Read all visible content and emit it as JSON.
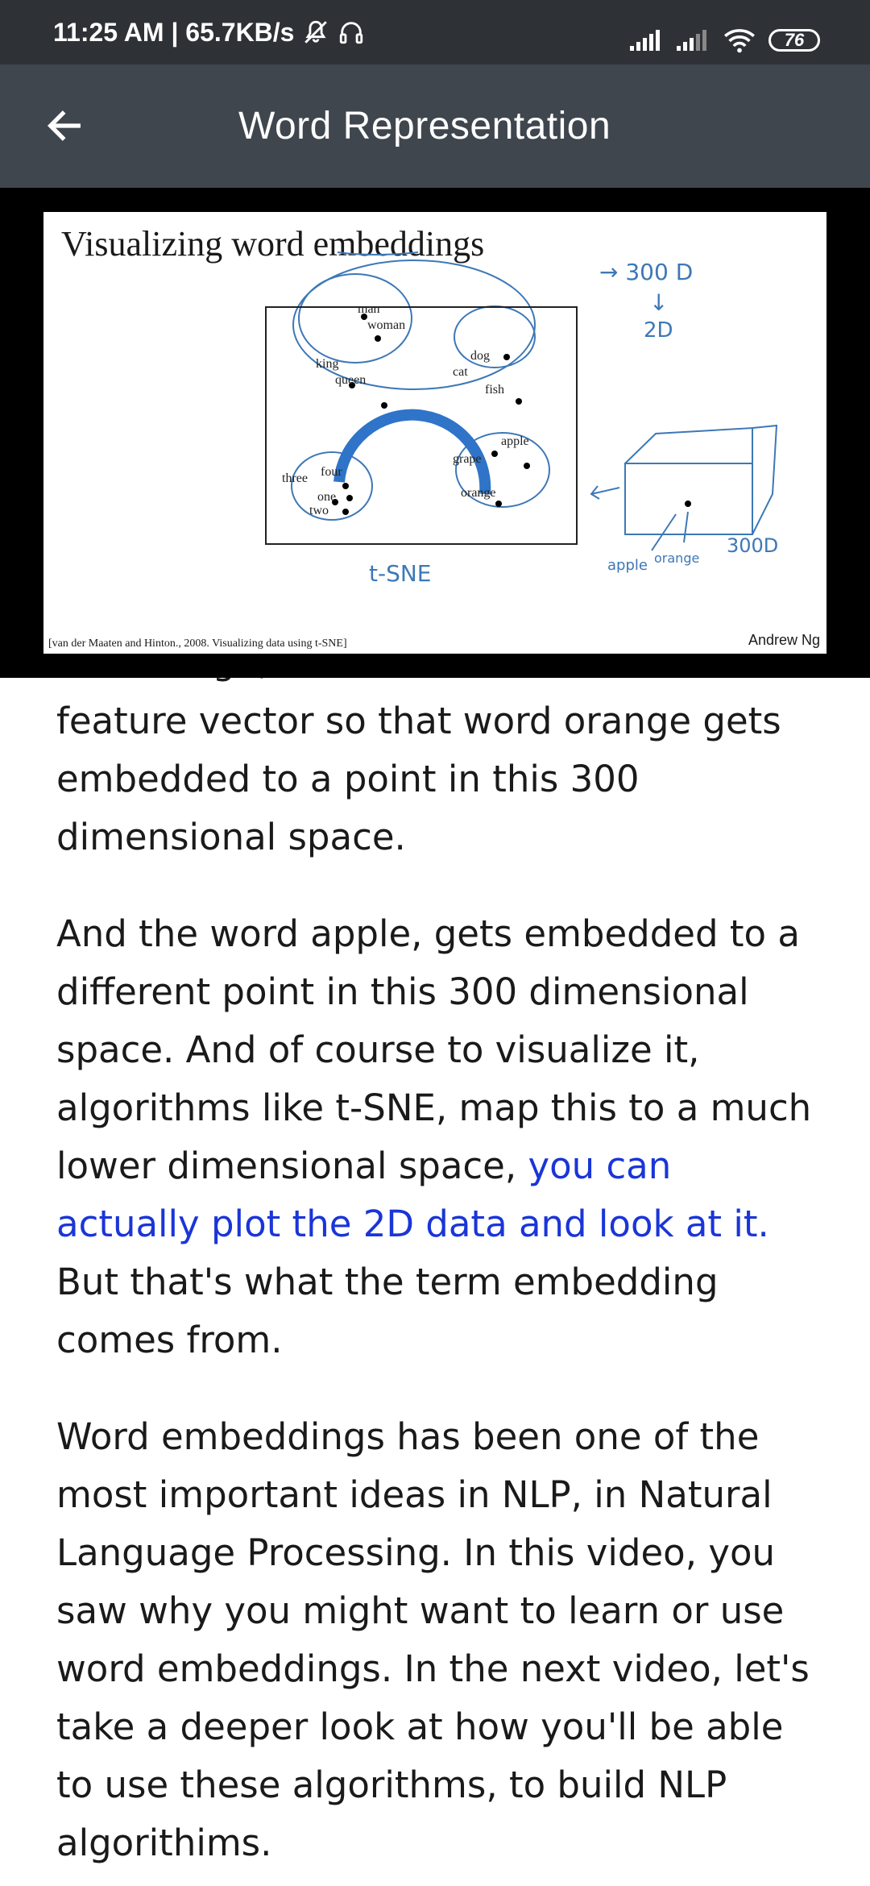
{
  "status_bar": {
    "time_speed": "11:25 AM | 65.7KB/s",
    "battery": "76"
  },
  "app_bar": {
    "title": "Word Representation"
  },
  "slide": {
    "title": "Visualizing word embeddings",
    "words": [
      "man",
      "woman",
      "king",
      "queen",
      "dog",
      "cat",
      "fish",
      "apple",
      "grape",
      "orange",
      "three",
      "four",
      "one",
      "two"
    ],
    "handwriting": {
      "dim_from": "→ 300 D",
      "arrow": "↓",
      "dim_to": "2D",
      "method": "t-SNE",
      "axis_label": "300D",
      "apple": "apple",
      "orange": "orange"
    },
    "citation": "[van der Maaten and Hinton., 2008. Visualizing data using t-SNE]",
    "author": "Andrew Ng"
  },
  "article": {
    "cut_line": "like orange, and have a three dimensional",
    "p1": "feature vector so that word orange gets embedded to a point in this 300 dimensional space.",
    "p2_before": "And the word apple, gets embedded to a different point in this 300 dimensional space. And of course to visualize it, algorithms like t-SNE, map this to a much lower dimensional space, ",
    "p2_highlight": "you can actually plot the 2D data and look at it.",
    "p2_after": " But that's what the term embedding comes from.",
    "p3": "Word embeddings has been one of the most important ideas in NLP, in Natural Language Processing. In this video, you saw why you might want to learn or use word embeddings. In the next video, let's take a deeper look at how you'll be able to use these algorithms, to build NLP algorithims."
  },
  "colors": {
    "status_bar": "#2e3237",
    "app_bar": "#3f464e",
    "highlight_text": "#1a35d8",
    "spinner": "#2f74c8",
    "handwriting": "#3d78b7"
  }
}
